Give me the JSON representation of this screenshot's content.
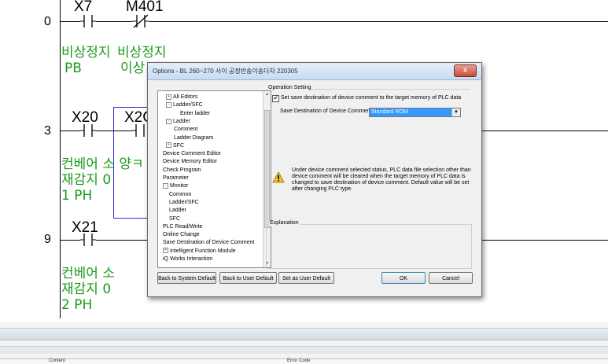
{
  "ladder": {
    "steps": [
      "0",
      "3",
      "9"
    ],
    "devices": {
      "x7": "X7",
      "m401": "M401",
      "x20": "X20",
      "x20_partial": "X2C",
      "x21": "X21"
    },
    "comments": {
      "x7_line1": "비상정지",
      "x7_line2": "PB",
      "m401_line1": "비상정지",
      "m401_line2": "이상",
      "x20_line1": "컨베어 소 양ㅋ",
      "x20_line2": "재감지 0",
      "x20_line3": "1 PH",
      "x21_line1": "컨베어 소",
      "x21_line2": "재감지 0",
      "x21_line3": "2 PH"
    }
  },
  "bottom_panel": {
    "col_contents": "Content",
    "col_error_code": "Error Code"
  },
  "dialog": {
    "title": "Options - BL 260~270 사이 공정반송이송다차 220305",
    "close_glyph": "x",
    "tree": [
      {
        "label": "All Editors",
        "pm": "+"
      },
      {
        "label": "Ladder/SFC",
        "pm": "-"
      },
      {
        "label": "Enter ladder",
        "pm": ""
      },
      {
        "label": "Ladder",
        "pm": "-"
      },
      {
        "label": "Comment",
        "pm": ""
      },
      {
        "label": "Ladder Diagram",
        "pm": ""
      },
      {
        "label": "SFC",
        "pm": "+"
      },
      {
        "label": "Device Comment Editor",
        "pm": ""
      },
      {
        "label": "Device Memory Editor",
        "pm": ""
      },
      {
        "label": "Check Program",
        "pm": ""
      },
      {
        "label": "Parameter",
        "pm": ""
      },
      {
        "label": "Monitor",
        "pm": "-"
      },
      {
        "label": "Common",
        "pm": ""
      },
      {
        "label": "Ladder/SFC",
        "pm": ""
      },
      {
        "label": "Ladder",
        "pm": ""
      },
      {
        "label": "SFC",
        "pm": ""
      },
      {
        "label": "PLC Read/Write",
        "pm": ""
      },
      {
        "label": "Online Change",
        "pm": ""
      },
      {
        "label": "Save Destination of Device Comment",
        "pm": ""
      },
      {
        "label": "Intelligent Function Module",
        "pm": "+"
      },
      {
        "label": "iQ Works Interaction",
        "pm": ""
      }
    ],
    "operation_setting": {
      "group_label": "Operation Setting",
      "checkbox_checked": "✔",
      "checkbox_label": "Set save destination of device comment to the target memory of PLC data",
      "dest_label": "Save Destination of Device Comment",
      "dest_value": "Standard ROM",
      "warning_line1": "Under device comment selected status, PLC data file selection other than",
      "warning_line2": "device comment will be cleared when the target memory of PLC data is",
      "warning_line3": "changed to save destination of device comment. Default value will be set",
      "warning_line4": "after changing PLC type."
    },
    "explanation_label": "Explanation",
    "buttons": {
      "back_system": "Back to System Default",
      "back_user": "Back to User Default",
      "set_user": "Set as User Default",
      "ok": "OK",
      "cancel": "Cancel"
    }
  }
}
